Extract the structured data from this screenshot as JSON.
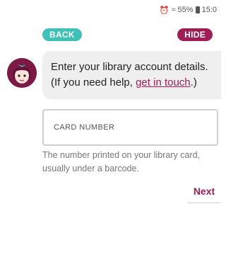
{
  "status_bar": {
    "battery": "55%",
    "time": "15:0",
    "icons": [
      "alarm-icon",
      "wifi-icon",
      "battery-icon"
    ]
  },
  "nav": {
    "back_label": "BACK",
    "hide_label": "HIDE"
  },
  "message": {
    "line1": "Enter your library account details.",
    "line2_prefix": "(If you need help, ",
    "link_text": "get in touch",
    "line2_suffix": ".)"
  },
  "card_input": {
    "placeholder": "CARD NUMBER",
    "value": ""
  },
  "helper_text": "The number printed on your library card, usually under a barcode.",
  "next_label": "Next",
  "colors": {
    "accent": "#9e1d55",
    "back_button": "#3fc0b8",
    "bubble": "#efefef"
  }
}
